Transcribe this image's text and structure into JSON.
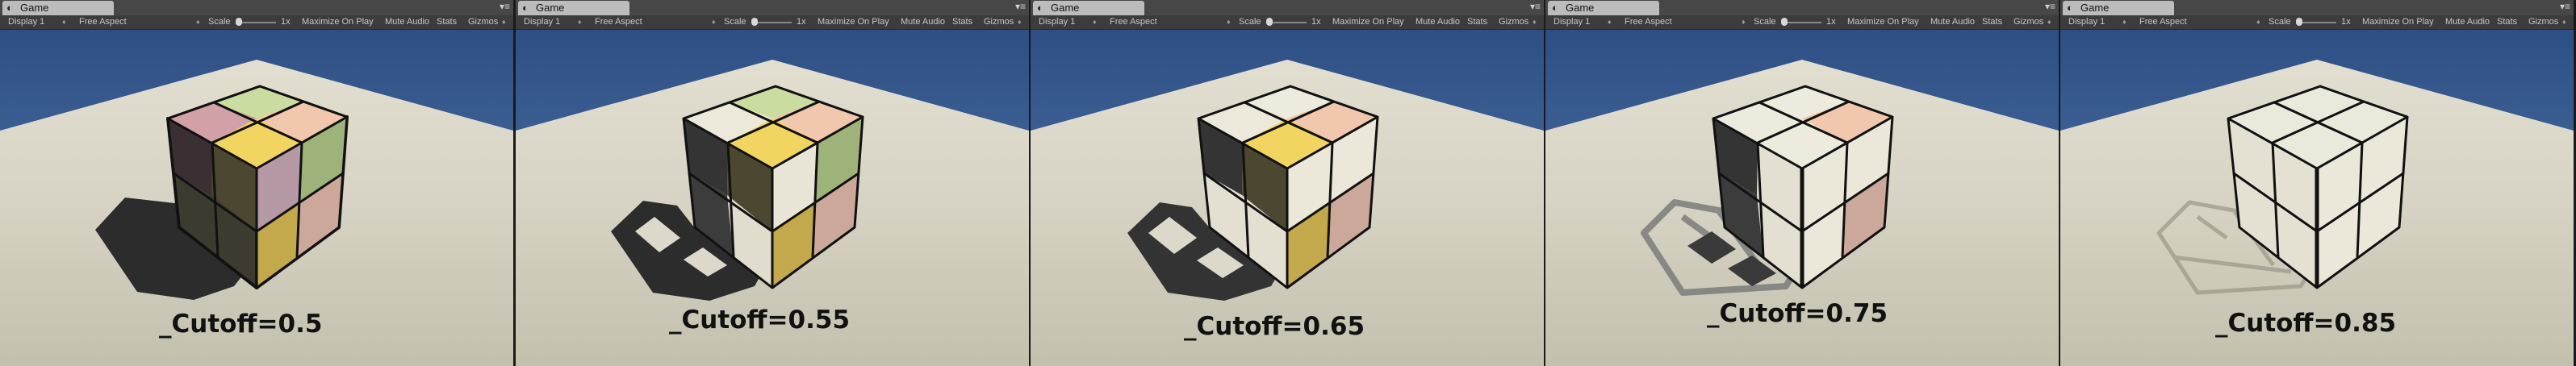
{
  "toolbar": {
    "display": "Display 1",
    "aspect": "Free Aspect",
    "scale_label": "Scale",
    "scale_value": "1x",
    "maximize": "Maximize On Play",
    "mute": "Mute Audio",
    "stats": "Stats",
    "gizmos": "Gizmos"
  },
  "panels": [
    {
      "tab": "Game",
      "label": "_Cutoff=0.5"
    },
    {
      "tab": "Game",
      "label": "_Cutoff=0.55"
    },
    {
      "tab": "Game",
      "label": "_Cutoff=0.65"
    },
    {
      "tab": "Game",
      "label": "_Cutoff=0.75"
    },
    {
      "tab": "Game",
      "label": "_Cutoff=0.85"
    }
  ],
  "colors": {
    "sky": "#2f5288",
    "ground": "#d8d5c6",
    "top_yellow": "#f2d560",
    "face_pink": "#d4a0a8",
    "face_green": "#aebf86",
    "face_peach": "#f0c6ae",
    "face_lightgreen": "#d0deaa"
  }
}
